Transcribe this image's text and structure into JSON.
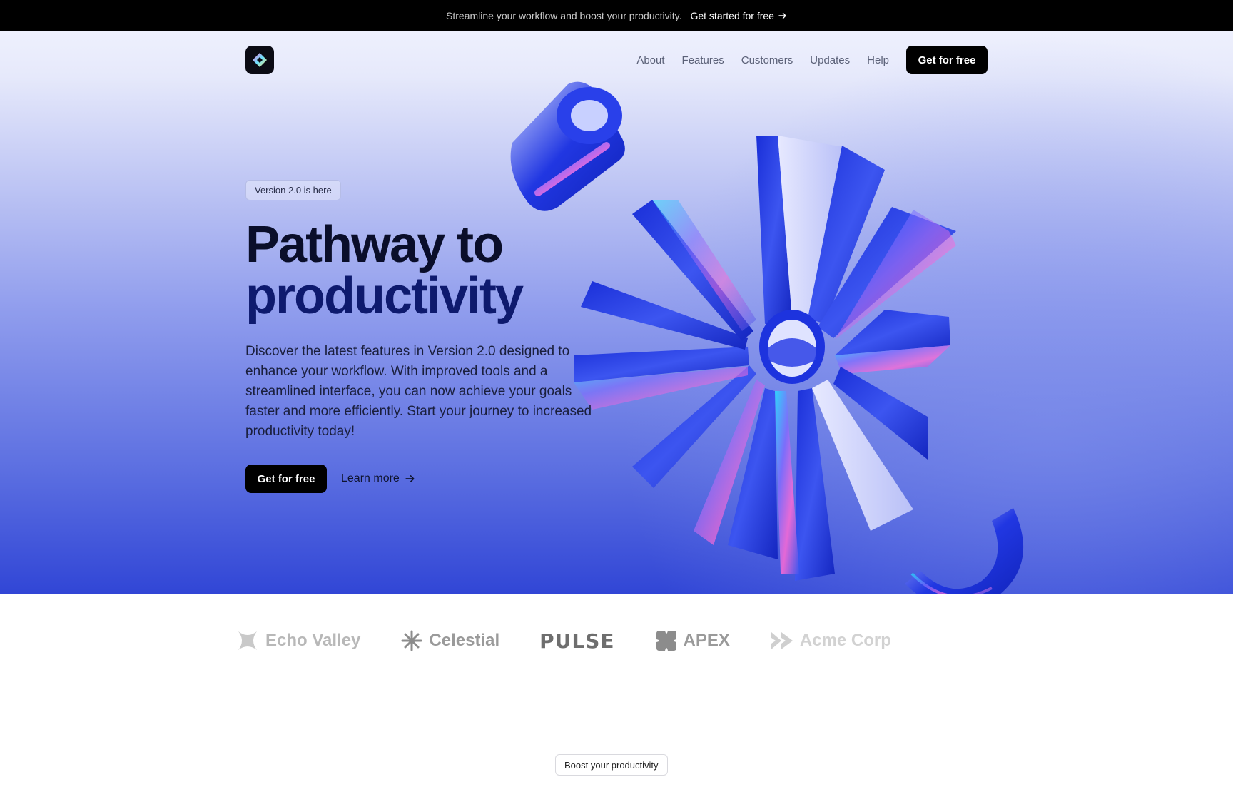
{
  "announcement": {
    "text": "Streamline your workflow and boost your productivity.",
    "link_label": "Get started for free"
  },
  "nav": {
    "links": [
      "About",
      "Features",
      "Customers",
      "Updates",
      "Help"
    ],
    "cta_label": "Get for free",
    "logo_icon": "diamond-logo-icon"
  },
  "hero": {
    "badge": "Version 2.0 is here",
    "title_line1": "Pathway to",
    "title_line2": "productivity",
    "description": "Discover the latest features in Version 2.0 designed to enhance your workflow. With improved tools and a streamlined interface, you can now achieve your goals faster and more efficiently. Start your journey to increased productivity today!",
    "primary_cta": "Get for free",
    "secondary_cta": "Learn more"
  },
  "logos": [
    {
      "name": "Echo Valley",
      "icon": "x-shape-icon"
    },
    {
      "name": "Celestial",
      "icon": "asterisk-icon"
    },
    {
      "name": "PULSE",
      "icon": ""
    },
    {
      "name": "APEX",
      "icon": "apex-cross-icon"
    },
    {
      "name": "Acme Corp",
      "icon": "chevrons-icon"
    }
  ],
  "section": {
    "badge": "Boost your productivity"
  },
  "colors": {
    "brand_dark": "#000000",
    "hero_top": "#eef0fd",
    "hero_bottom": "#3146d6",
    "accent_blue": "#2b3fe0"
  }
}
